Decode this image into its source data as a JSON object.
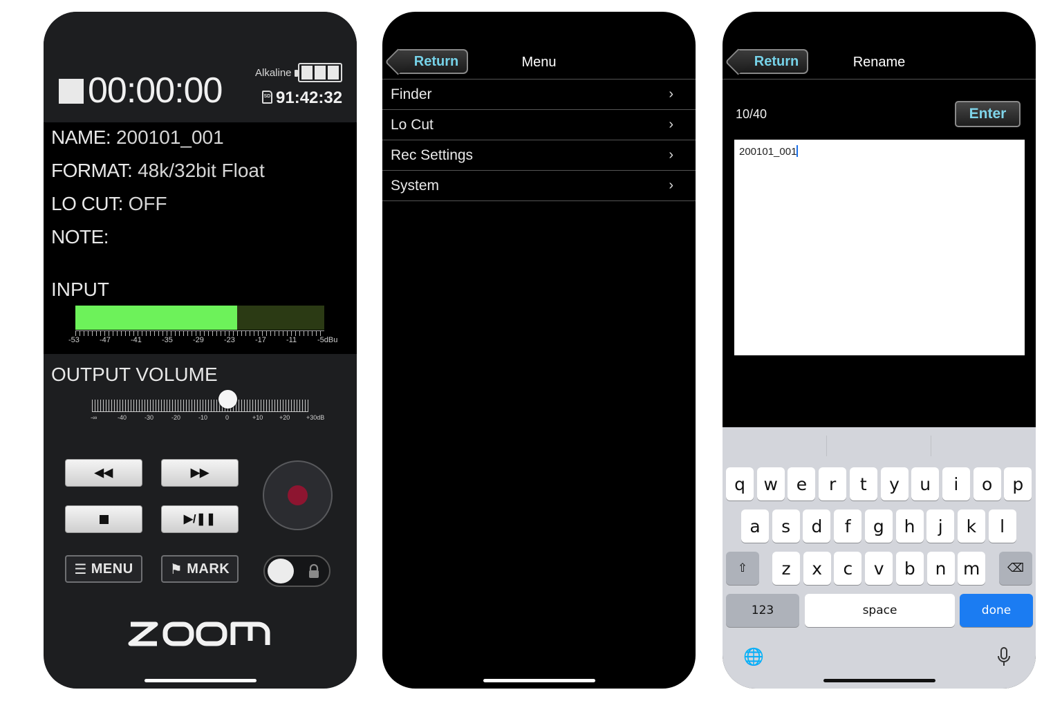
{
  "recorder": {
    "timecode": "00:00:00",
    "battery_type": "Alkaline",
    "remaining_time": "91:42:32",
    "name_label": "NAME:",
    "name_value": "200101_001",
    "format_label": "FORMAT:",
    "format_value": "48k/32bit Float",
    "locut_label": "LO CUT:",
    "locut_value": "OFF",
    "note_label": "NOTE:",
    "note_value": "",
    "input_label": "INPUT",
    "input_level_fraction": 0.65,
    "input_scale": [
      "-53",
      "-47",
      "-41",
      "-35",
      "-29",
      "-23",
      "-17",
      "-11",
      "-5dBu"
    ],
    "output_label": "OUTPUT VOLUME",
    "output_volume_db": 0,
    "output_scale": [
      "-∞",
      "-40",
      "-30",
      "-20",
      "-10",
      "0",
      "+10",
      "+20",
      "+30dB"
    ],
    "menu_label": "MENU",
    "mark_label": "MARK",
    "logo": "ZOOM",
    "colors": {
      "meter_fill": "#6df25a",
      "meter_bg": "#2b3a14",
      "rec_dot": "#8d1530"
    }
  },
  "menu_screen": {
    "return_label": "Return",
    "title": "Menu",
    "items": [
      {
        "label": "Finder"
      },
      {
        "label": "Lo Cut"
      },
      {
        "label": "Rec Settings"
      },
      {
        "label": "System"
      }
    ]
  },
  "rename_screen": {
    "return_label": "Return",
    "title": "Rename",
    "char_count": "10/40",
    "enter_label": "Enter",
    "text_value": "200101_001",
    "keyboard": {
      "row1": [
        "q",
        "w",
        "e",
        "r",
        "t",
        "y",
        "u",
        "i",
        "o",
        "p"
      ],
      "row2": [
        "a",
        "s",
        "d",
        "f",
        "g",
        "h",
        "j",
        "k",
        "l"
      ],
      "row3": [
        "z",
        "x",
        "c",
        "v",
        "b",
        "n",
        "m"
      ],
      "numbers_label": "123",
      "space_label": "space",
      "done_label": "done"
    },
    "colors": {
      "done_key": "#1b7cf2",
      "accent_text": "#7fd4e9"
    }
  }
}
